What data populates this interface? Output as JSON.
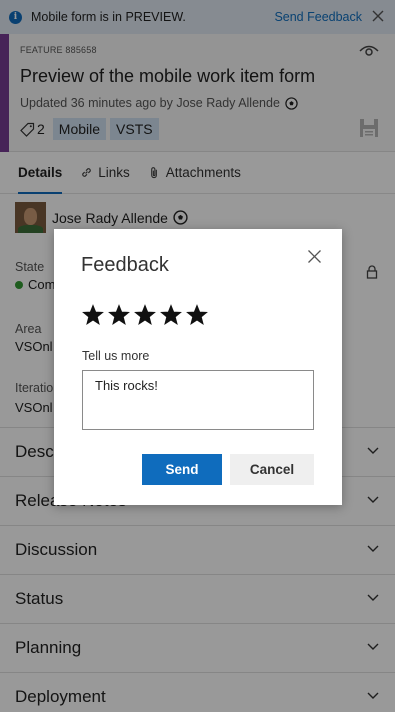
{
  "banner": {
    "message": "Mobile form is in PREVIEW.",
    "feedback_link": "Send Feedback",
    "info_icon": "info-icon",
    "close_icon": "close-icon"
  },
  "work_item": {
    "type_id": "FEATURE 885658",
    "title": "Preview of the mobile work item form",
    "updated": "Updated 36 minutes ago by Jose Rady Allende",
    "tag_count": "2",
    "tags": [
      "Mobile",
      "VSTS"
    ],
    "type_color": "#773b93"
  },
  "tabs": [
    {
      "label": "Details",
      "active": true
    },
    {
      "label": "Links",
      "active": false
    },
    {
      "label": "Attachments",
      "active": false
    }
  ],
  "details": {
    "assigned_to": "Jose Rady Allende",
    "state_label": "State",
    "state_value": "Com",
    "area_label": "Area",
    "area_value": "VSOnl",
    "iteration_label": "Iteratio",
    "iteration_value": "VSOnl"
  },
  "sections": [
    "Desc",
    "Release Notes",
    "Discussion",
    "Status",
    "Planning",
    "Deployment"
  ],
  "feedback_dialog": {
    "title": "Feedback",
    "rating": 5,
    "rating_max": 5,
    "prompt": "Tell us more",
    "comment": "This rocks!",
    "send_label": "Send",
    "cancel_label": "Cancel"
  },
  "colors": {
    "accent": "#0f6cbd",
    "state_dot": "#339933",
    "tag_bg": "#cfe0f1"
  }
}
